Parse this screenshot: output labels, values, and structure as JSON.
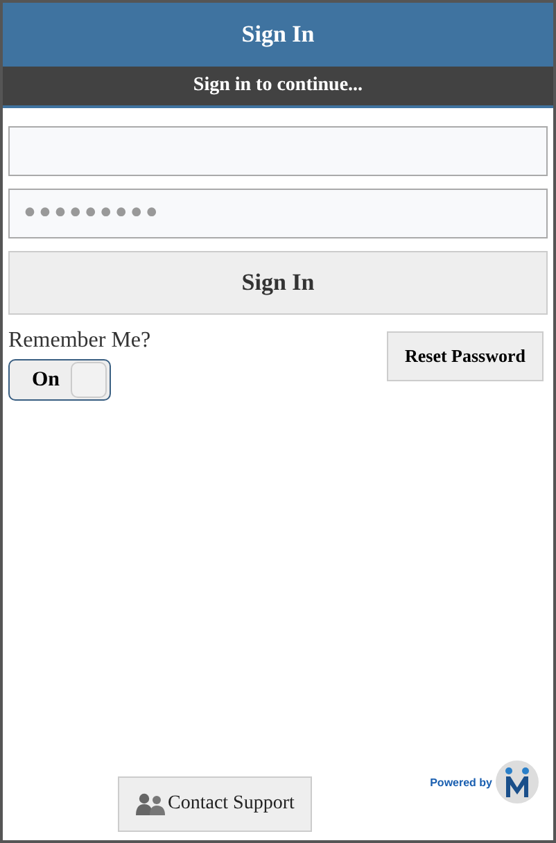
{
  "header": {
    "title": "Sign In",
    "subtitle": "Sign in to continue..."
  },
  "form": {
    "password": {
      "value": "•••••••••"
    },
    "sign_in_button": "Sign In",
    "remember": {
      "label": "Remember Me?",
      "on": true,
      "on_label": "On"
    },
    "reset_button": "Reset Password"
  },
  "footer": {
    "contact_button": "Contact Support",
    "powered_by": "Powered by"
  }
}
